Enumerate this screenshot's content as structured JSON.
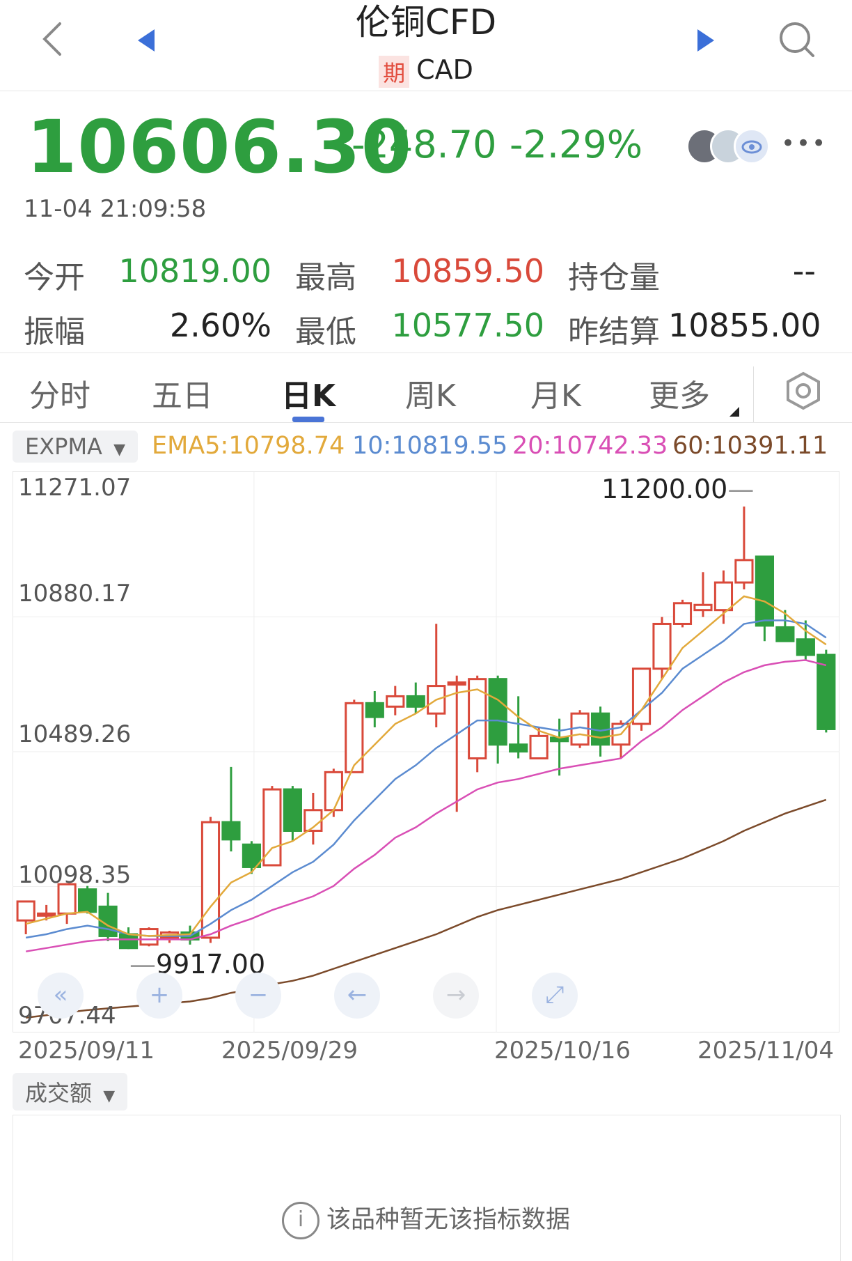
{
  "header": {
    "title": "伦铜CFD",
    "tag": "期",
    "subtitle": "CAD"
  },
  "quote": {
    "price": "10606.30",
    "change": "-248.70",
    "change_pct": "-2.29%",
    "time": "11-04 21:09:58"
  },
  "stats": {
    "open_label": "今开",
    "open": "10819.00",
    "high_label": "最高",
    "high": "10859.50",
    "oi_label": "持仓量",
    "oi": "--",
    "amp_label": "振幅",
    "amp": "2.60%",
    "low_label": "最低",
    "low": "10577.50",
    "settle_label": "昨结算",
    "settle": "10855.00"
  },
  "tabs": [
    "分时",
    "五日",
    "日K",
    "周K",
    "月K",
    "更多"
  ],
  "indicator": {
    "selector": "EXPMA",
    "ema5": "EMA5:10798.74",
    "ema10": "10:10819.55",
    "ema20": "20:10742.33",
    "ema60": "60:10391.11"
  },
  "volume": {
    "selector": "成交额",
    "empty_text": "该品种暂无该指标数据"
  },
  "colors": {
    "up": "#d9493a",
    "down": "#2e9e3f",
    "ema5": "#e2a93b",
    "ema10": "#5b8bd0",
    "ema20": "#d94fb5",
    "ema60": "#7b4a2a"
  },
  "chart_data": {
    "type": "candlestick",
    "y_ticks": [
      "11271.07",
      "10880.17",
      "10489.26",
      "10098.35",
      "9707.44"
    ],
    "x_ticks": [
      "2025/09/11",
      "2025/09/29",
      "2025/10/16",
      "2025/11/04"
    ],
    "ylim": [
      9707.44,
      11271.07
    ],
    "annotations": {
      "max": "11200.00",
      "min": "9917.00"
    },
    "candles": [
      {
        "o": 10000,
        "h": 10040,
        "l": 9960,
        "c": 10055
      },
      {
        "o": 10020,
        "h": 10045,
        "l": 10000,
        "c": 10020
      },
      {
        "o": 10020,
        "h": 10100,
        "l": 9990,
        "c": 10105
      },
      {
        "o": 10090,
        "h": 10100,
        "l": 10020,
        "c": 10025
      },
      {
        "o": 10040,
        "h": 10080,
        "l": 9940,
        "c": 9955
      },
      {
        "o": 9960,
        "h": 9980,
        "l": 9917,
        "c": 9920
      },
      {
        "o": 9930,
        "h": 9980,
        "l": 9925,
        "c": 9975
      },
      {
        "o": 9950,
        "h": 9970,
        "l": 9935,
        "c": 9965
      },
      {
        "o": 9965,
        "h": 9985,
        "l": 9930,
        "c": 9945
      },
      {
        "o": 9950,
        "h": 10300,
        "l": 9935,
        "c": 10285
      },
      {
        "o": 10285,
        "h": 10445,
        "l": 10200,
        "c": 10235
      },
      {
        "o": 10220,
        "h": 10230,
        "l": 10135,
        "c": 10155
      },
      {
        "o": 10160,
        "h": 10390,
        "l": 10160,
        "c": 10380
      },
      {
        "o": 10380,
        "h": 10390,
        "l": 10230,
        "c": 10260
      },
      {
        "o": 10260,
        "h": 10370,
        "l": 10220,
        "c": 10320
      },
      {
        "o": 10320,
        "h": 10440,
        "l": 10300,
        "c": 10430
      },
      {
        "o": 10430,
        "h": 10640,
        "l": 10430,
        "c": 10630
      },
      {
        "o": 10630,
        "h": 10665,
        "l": 10560,
        "c": 10590
      },
      {
        "o": 10620,
        "h": 10680,
        "l": 10595,
        "c": 10650
      },
      {
        "o": 10650,
        "h": 10690,
        "l": 10600,
        "c": 10620
      },
      {
        "o": 10600,
        "h": 10860,
        "l": 10560,
        "c": 10680
      },
      {
        "o": 10690,
        "h": 10710,
        "l": 10315,
        "c": 10690
      },
      {
        "o": 10470,
        "h": 10710,
        "l": 10430,
        "c": 10700
      },
      {
        "o": 10700,
        "h": 10710,
        "l": 10455,
        "c": 10510
      },
      {
        "o": 10510,
        "h": 10650,
        "l": 10470,
        "c": 10490
      },
      {
        "o": 10470,
        "h": 10560,
        "l": 10475,
        "c": 10535
      },
      {
        "o": 10530,
        "h": 10585,
        "l": 10420,
        "c": 10520
      },
      {
        "o": 10510,
        "h": 10610,
        "l": 10500,
        "c": 10600
      },
      {
        "o": 10600,
        "h": 10620,
        "l": 10475,
        "c": 10510
      },
      {
        "o": 10510,
        "h": 10580,
        "l": 10470,
        "c": 10570
      },
      {
        "o": 10570,
        "h": 10700,
        "l": 10550,
        "c": 10730
      },
      {
        "o": 10730,
        "h": 10880,
        "l": 10700,
        "c": 10860
      },
      {
        "o": 10860,
        "h": 10930,
        "l": 10850,
        "c": 10920
      },
      {
        "o": 10900,
        "h": 11010,
        "l": 10880,
        "c": 10915
      },
      {
        "o": 10900,
        "h": 11015,
        "l": 10860,
        "c": 10980
      },
      {
        "o": 10980,
        "h": 11200,
        "l": 10960,
        "c": 11045
      },
      {
        "o": 11055,
        "h": 11055,
        "l": 10810,
        "c": 10855
      },
      {
        "o": 10850,
        "h": 10900,
        "l": 10810,
        "c": 10810
      },
      {
        "o": 10815,
        "h": 10870,
        "l": 10755,
        "c": 10770
      },
      {
        "o": 10770,
        "h": 10785,
        "l": 10545,
        "c": 10555
      }
    ],
    "ema5": [
      9990,
      10005,
      10020,
      10025,
      9985,
      9960,
      9955,
      9958,
      9960,
      10040,
      10110,
      10140,
      10210,
      10230,
      10270,
      10320,
      10450,
      10510,
      10570,
      10600,
      10640,
      10660,
      10670,
      10640,
      10590,
      10550,
      10530,
      10540,
      10530,
      10540,
      10610,
      10700,
      10790,
      10840,
      10890,
      10940,
      10925,
      10890,
      10840,
      10800
    ],
    "ema10": [
      9950,
      9960,
      9975,
      9985,
      9975,
      9960,
      9955,
      9955,
      9955,
      9990,
      10030,
      10060,
      10100,
      10140,
      10170,
      10220,
      10290,
      10350,
      10410,
      10450,
      10500,
      10540,
      10580,
      10580,
      10570,
      10560,
      10550,
      10560,
      10550,
      10560,
      10610,
      10660,
      10730,
      10770,
      10810,
      10860,
      10870,
      10870,
      10860,
      10820
    ],
    "ema20": [
      9910,
      9920,
      9930,
      9940,
      9945,
      9945,
      9945,
      9945,
      9945,
      9960,
      9985,
      10005,
      10030,
      10050,
      10070,
      10100,
      10150,
      10190,
      10240,
      10270,
      10310,
      10345,
      10380,
      10400,
      10410,
      10425,
      10440,
      10450,
      10460,
      10470,
      10520,
      10560,
      10610,
      10650,
      10690,
      10720,
      10740,
      10750,
      10755,
      10740
    ],
    "ema60": [
      9718,
      9725,
      9733,
      9740,
      9745,
      9750,
      9755,
      9760,
      9765,
      9775,
      9790,
      9800,
      9815,
      9825,
      9840,
      9860,
      9880,
      9900,
      9920,
      9940,
      9960,
      9985,
      10010,
      10030,
      10045,
      10060,
      10075,
      10090,
      10105,
      10120,
      10140,
      10160,
      10180,
      10205,
      10230,
      10260,
      10285,
      10310,
      10330,
      10350
    ]
  }
}
